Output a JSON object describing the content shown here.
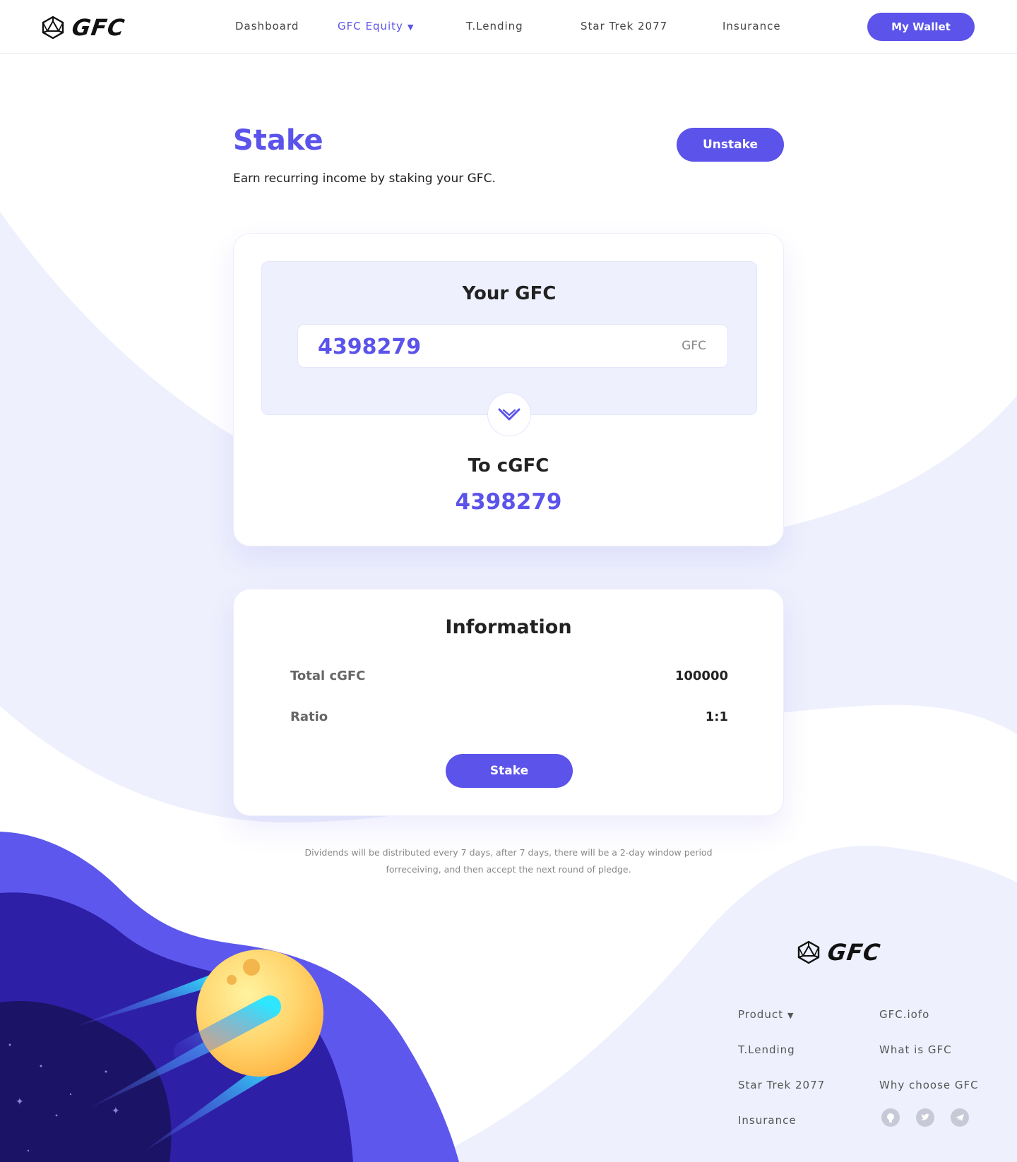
{
  "brand": {
    "name": "GFC",
    "accent": "#5b53ea",
    "wave_color": "#eef0fd"
  },
  "header": {
    "nav": [
      {
        "label": "Dashboard"
      },
      {
        "label": "GFC Equity",
        "active": true,
        "dropdown": true
      },
      {
        "label": "T.Lending"
      },
      {
        "label": "Star Trek 2077"
      },
      {
        "label": "Insurance"
      }
    ],
    "wallet_label": "My Wallet"
  },
  "page": {
    "title": "Stake",
    "subtitle": "Earn recurring income by staking your GFC.",
    "unstake_label": "Unstake"
  },
  "stake_card": {
    "your_title": "Your GFC",
    "amount_value": "4398279",
    "unit": "GFC",
    "to_title": "To cGFC",
    "to_value": "4398279",
    "swap_icon": "chevron-down-icon"
  },
  "info_card": {
    "title": "Information",
    "rows": [
      {
        "label": "Total cGFC",
        "value": "100000"
      },
      {
        "label": "Ratio",
        "value": "1:1"
      }
    ],
    "stake_label": "Stake"
  },
  "note": {
    "line1": "Dividends will be distributed every 7 days, after 7 days, there will be a 2-day window period",
    "line2": "forreceiving, and then accept the next round of pledge."
  },
  "footer": {
    "col1": [
      "Product",
      "T.Lending",
      "Star Trek 2077",
      "Insurance"
    ],
    "col2": [
      "GFC.iofo",
      "What is GFC",
      "Why choose GFC"
    ],
    "social_icons": [
      "github-icon",
      "twitter-icon",
      "telegram-icon"
    ]
  }
}
